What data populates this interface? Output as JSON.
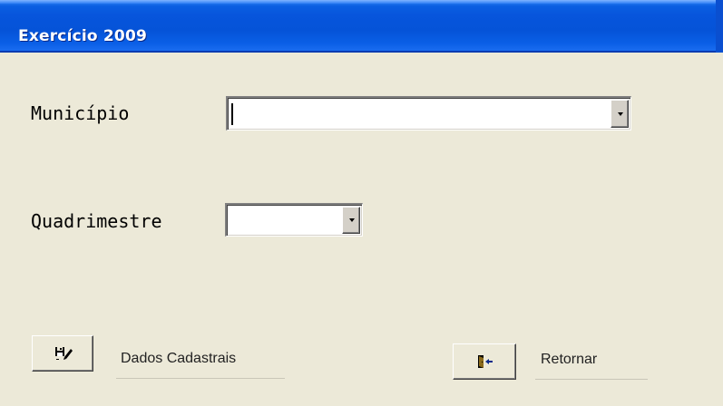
{
  "window": {
    "title": "Exercício 2009"
  },
  "form": {
    "municipio_label": "Município",
    "municipio_value": "",
    "quadrimestre_label": "Quadrimestre",
    "quadrimestre_value": ""
  },
  "buttons": {
    "dados_cadastrais_label": "Dados Cadastrais",
    "dados_cadastrais_icon": "save-edit-icon",
    "retornar_label": "Retornar",
    "retornar_icon": "exit-door-icon"
  },
  "colors": {
    "titlebar": "#0553d8",
    "window_bg": "#ece9d8",
    "field_bg": "#ffffff"
  }
}
